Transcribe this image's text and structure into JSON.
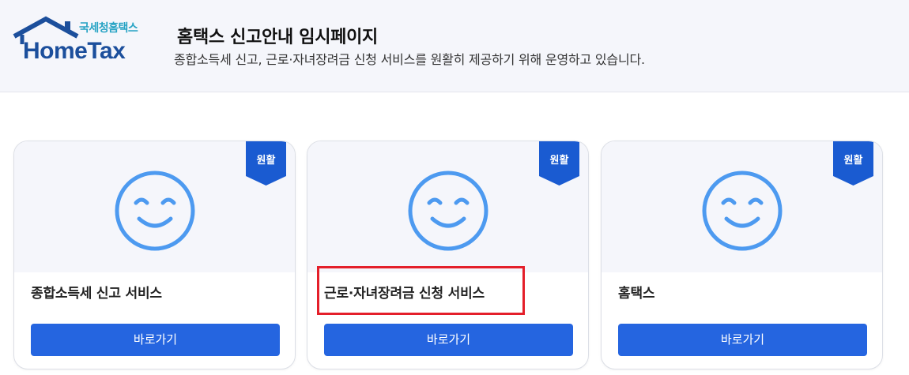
{
  "header": {
    "logo": {
      "sub_text": "국세청홈택스",
      "main_text": "HomeTax"
    },
    "title": "홈택스 신고안내 임시페이지",
    "description": "종합소득세 신고, 근로·자녀장려금 신청 서비스를 원활히 제공하기 위해 운영하고 있습니다."
  },
  "cards": [
    {
      "status_badge": "원활",
      "title": "종합소득세 신고 서비스",
      "button_label": "바로가기",
      "icon": "smile-icon"
    },
    {
      "status_badge": "원활",
      "title": "근로·자녀장려금 신청 서비스",
      "button_label": "바로가기",
      "icon": "smile-icon"
    },
    {
      "status_badge": "원활",
      "title": "홈택스",
      "button_label": "바로가기",
      "icon": "smile-icon"
    }
  ],
  "colors": {
    "brand_blue": "#1c4f9c",
    "logo_teal": "#27a3c4",
    "button_blue": "#2565e0",
    "badge_blue": "#1a5bd1",
    "smile_blue": "#4d9af0",
    "highlight_red": "#e41f2a",
    "header_bg": "#f5f6fb"
  }
}
